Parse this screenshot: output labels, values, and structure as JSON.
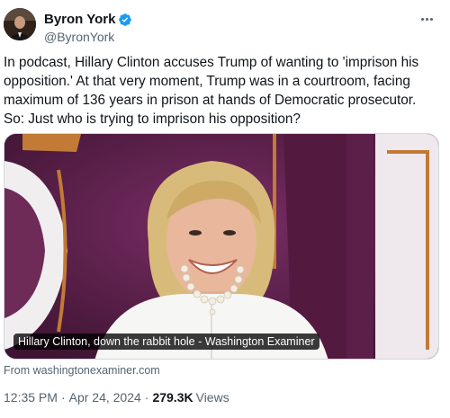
{
  "author": {
    "name": "Byron York",
    "handle": "@ByronYork",
    "verified": true,
    "verified_color": "#1d9bf0"
  },
  "tweet": {
    "text": "In podcast, Hillary Clinton accuses Trump of wanting to 'imprison his opposition.' At that very moment, Trump was in a courtroom, facing maximum of 136 years in prison at hands of Democratic prosecutor. So: Just who is trying to imprison his opposition?"
  },
  "card": {
    "caption": "Hillary Clinton, down the rabbit hole - Washington Examiner",
    "source": "From washingtonexaminer.com"
  },
  "meta": {
    "time": "12:35 PM",
    "separator": "·",
    "date": "Apr 24, 2024",
    "views_count": "279.3K",
    "views_label": "Views"
  },
  "icons": {
    "more": "more-horizontal-icon",
    "verified": "verified-badge-icon"
  }
}
